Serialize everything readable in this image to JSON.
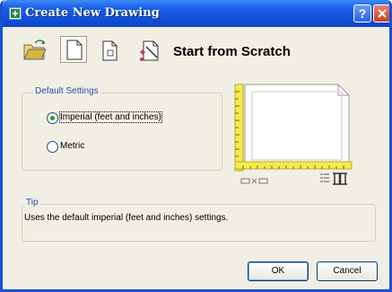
{
  "window": {
    "title": "Create New Drawing"
  },
  "titlebar_buttons": {
    "help_label": "?"
  },
  "toolbar": {
    "items": [
      {
        "icon": "open-drawing-icon",
        "selected": false
      },
      {
        "icon": "start-from-scratch-icon",
        "selected": true
      },
      {
        "icon": "use-template-icon",
        "selected": false
      },
      {
        "icon": "use-wizard-icon",
        "selected": false
      }
    ],
    "heading": "Start from Scratch"
  },
  "default_settings": {
    "label": "Default Settings",
    "options": [
      {
        "label": "Imperial (feet and inches)",
        "selected": true
      },
      {
        "label": "Metric",
        "selected": false
      }
    ]
  },
  "tip": {
    "label": "Tip",
    "text": "Uses the default imperial (feet and inches) settings."
  },
  "buttons": {
    "ok": "OK",
    "cancel": "Cancel"
  },
  "colors": {
    "title_bar": "#1150d8",
    "ruler": "#f3ec4a",
    "radio_selected": "#21a121"
  }
}
